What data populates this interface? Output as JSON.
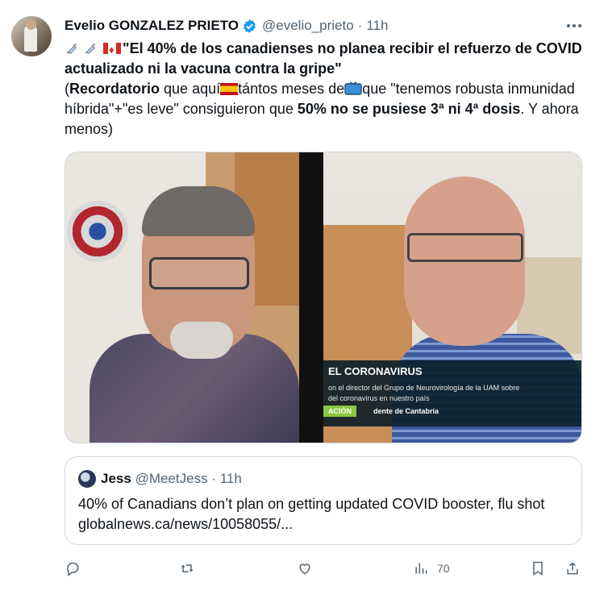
{
  "author": {
    "name": "Evelio GONZALEZ PRIETO",
    "handle": "@evelio_prieto",
    "time": "11h",
    "verified": true
  },
  "tweet": {
    "line1_bold": "\"El 40% de los canadienses no planea recibir el refuerzo de COVID actualizado ni la vacuna contra la gripe\"",
    "line2_open": "(",
    "line2_bold": "Recordatorio",
    "line2_a": " que aquí",
    "line2_b": "tántos meses de",
    "line2_c": "que \"tenemos robusta inmunidad híbrida\"+\"es leve\" consiguieron que ",
    "line2_bold2": "50% no se pusiese 3ª ni 4ª dosis",
    "line2_end": ". Y ahora menos)"
  },
  "media": {
    "banner_title": "EL CORONAVIRUS",
    "banner_sub1": "on el director del Grupo de Neurovirología de la UAM sobre",
    "banner_sub2": "del coronavirus en nuestro país",
    "banner_tag": "ACIÓN",
    "banner_role": "dente de Cantabria"
  },
  "quote": {
    "name": "Jess",
    "handle": "@MeetJess",
    "time": "11h",
    "text": "40% of Canadians don’t plan on getting updated COVID booster, flu shot globalnews.ca/news/10058055/..."
  },
  "actions": {
    "views": "70"
  },
  "colors": {
    "verified": "#1d9bf0",
    "muted": "#536471",
    "border": "#cfd9de"
  },
  "icons": [
    "syringe-icon",
    "canada-flag-icon",
    "spain-flag-icon",
    "tv-icon",
    "verified-badge-icon",
    "more-icon",
    "reply-icon",
    "retweet-icon",
    "like-icon",
    "views-icon",
    "bookmark-icon",
    "share-icon"
  ]
}
